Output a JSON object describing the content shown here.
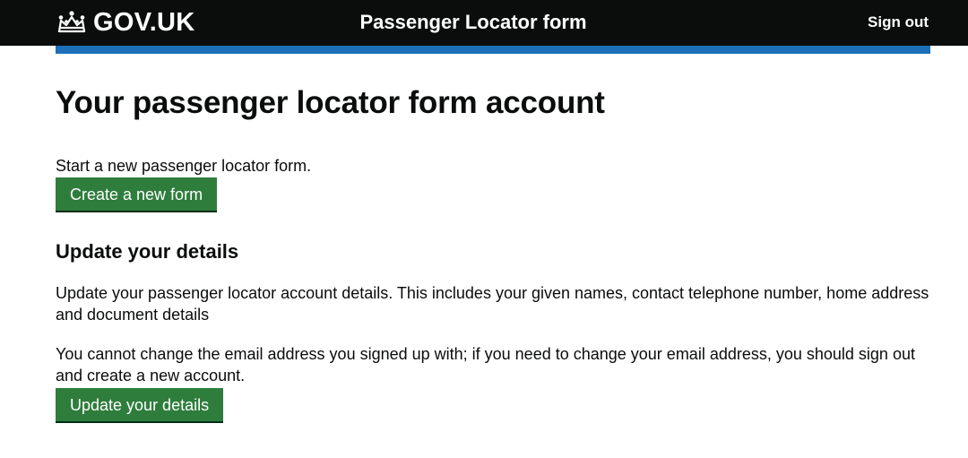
{
  "header": {
    "logo_text": "GOV.UK",
    "logo_icon": "crown-icon",
    "service_name": "Passenger Locator form",
    "sign_out_label": "Sign out"
  },
  "main": {
    "title": "Your passenger locator form account",
    "intro": "Start a new passenger locator form.",
    "create_button_label": "Create a new form",
    "update_heading": "Update your details",
    "update_paragraph_1": "Update your passenger locator account details. This includes your given names, contact telephone number, home address and document details",
    "update_paragraph_2": "You cannot change the email address you signed up with; if you need to change your email address, you should sign out and create a new account.",
    "update_button_label": "Update your details"
  },
  "colors": {
    "header_background": "#0b0c0c",
    "header_accent": "#1d70b8",
    "button_green": "#2e7d3c"
  }
}
